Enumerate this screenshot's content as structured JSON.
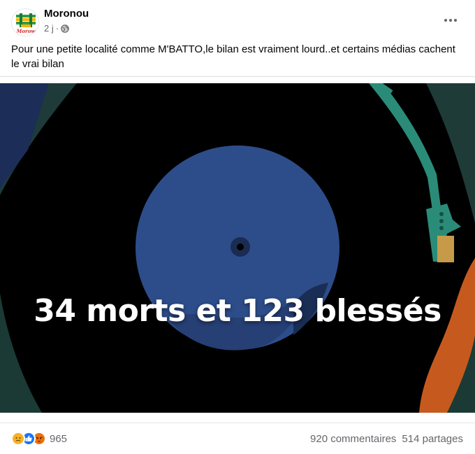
{
  "post": {
    "author": "Moronou",
    "time": "2 j",
    "separator": "·",
    "privacy_icon": "globe-icon",
    "more_icon": "more-options-icon",
    "text": "Pour une petite localité comme M'BATTO,le bilan est vraiment lourd..et certains médias cachent le vrai bilan",
    "avatar_text": "Morow"
  },
  "media": {
    "headline": "34 morts et 123 blessés"
  },
  "stats": {
    "reactions": [
      "sad",
      "like",
      "angry"
    ],
    "reaction_count": "965",
    "comments": "920 commentaires",
    "shares": "514 partages"
  },
  "colors": {
    "like": "#1877f2",
    "sad": "#f7b125",
    "angry": "#e9710f",
    "record_label": "#2d4d8a",
    "tonearm": "#2a8c78"
  }
}
